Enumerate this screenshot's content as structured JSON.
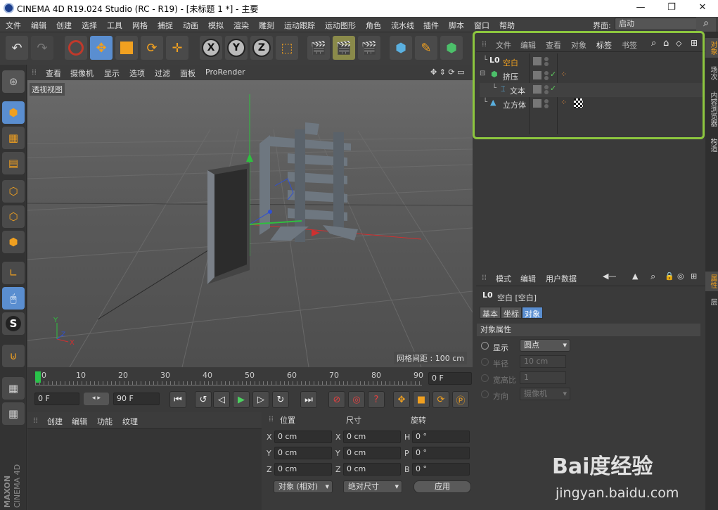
{
  "titlebar": {
    "title": "CINEMA 4D R19.024 Studio (RC - R19) - [未标题 1 *] - 主要",
    "minimize": "—",
    "maximize": "❐",
    "close": "✕"
  },
  "menubar": {
    "items": [
      "文件",
      "编辑",
      "创建",
      "选择",
      "工具",
      "网格",
      "捕捉",
      "动画",
      "模拟",
      "渲染",
      "雕刻",
      "运动跟踪",
      "运动图形",
      "角色",
      "流水线",
      "插件",
      "脚本",
      "窗口",
      "帮助"
    ]
  },
  "interface": {
    "label": "界面:",
    "value": "启动"
  },
  "viewport": {
    "menu": [
      "查看",
      "摄像机",
      "显示",
      "选项",
      "过滤",
      "面板",
      "ProRender"
    ],
    "label": "透视视图",
    "grid_spacing": "网格间距 : 100 cm",
    "axis_labels": {
      "y": "Y",
      "z": "Z",
      "x": "X"
    }
  },
  "timeline": {
    "ticks": [
      "0",
      "10",
      "20",
      "30",
      "40",
      "50",
      "60",
      "70",
      "80",
      "90"
    ],
    "current_frame": "0 F"
  },
  "playback": {
    "start_field": "0 F",
    "end_field": "90 F"
  },
  "materials": {
    "menu": [
      "创建",
      "编辑",
      "功能",
      "纹理"
    ]
  },
  "coordinates": {
    "headers": {
      "position": "位置",
      "size": "尺寸",
      "rotation": "旋转"
    },
    "pos": {
      "x_label": "X",
      "x": "0 cm",
      "y_label": "Y",
      "y": "0 cm",
      "z_label": "Z",
      "z": "0 cm"
    },
    "size": {
      "x_label": "X",
      "x": "0 cm",
      "y_label": "Y",
      "y": "0 cm",
      "z_label": "Z",
      "z": "0 cm"
    },
    "rot": {
      "h_label": "H",
      "h": "0 °",
      "p_label": "P",
      "p": "0 °",
      "b_label": "B",
      "b": "0 °"
    },
    "mode_select": "对象 (相对)",
    "size_select": "绝对尺寸",
    "apply": "应用"
  },
  "objects": {
    "menu": [
      "文件",
      "编辑",
      "查看",
      "对象",
      "标签",
      "书签"
    ],
    "items": [
      {
        "name": "空白",
        "icon": "null-icon"
      },
      {
        "name": "挤压",
        "icon": "extrude-icon"
      },
      {
        "name": "文本",
        "icon": "text-spline-icon"
      },
      {
        "name": "立方体",
        "icon": "cube-icon"
      }
    ]
  },
  "attributes": {
    "menu": [
      "模式",
      "编辑",
      "用户数据"
    ],
    "object_title": "空白 [空白]",
    "tabs": [
      "基本",
      "坐标",
      "对象"
    ],
    "section": "对象属性",
    "rows": [
      {
        "label": "显示",
        "value": "圆点"
      },
      {
        "label": "半径",
        "value": "10 cm"
      },
      {
        "label": "宽高比",
        "value": "1"
      },
      {
        "label": "方向",
        "value": "摄像机"
      }
    ]
  },
  "right_tabs": [
    "对象",
    "场次",
    "内容浏览器",
    "构造",
    "属性",
    "层"
  ],
  "branding": {
    "maxon": "MAXON",
    "product": "CINEMA 4D"
  },
  "watermark": {
    "brand": "Bai度经验",
    "url": "jingyan.baidu.com"
  },
  "colors": {
    "accent_orange": "#f0a020",
    "highlight_green": "#8cc63e",
    "active_blue": "#5a8ed0"
  }
}
